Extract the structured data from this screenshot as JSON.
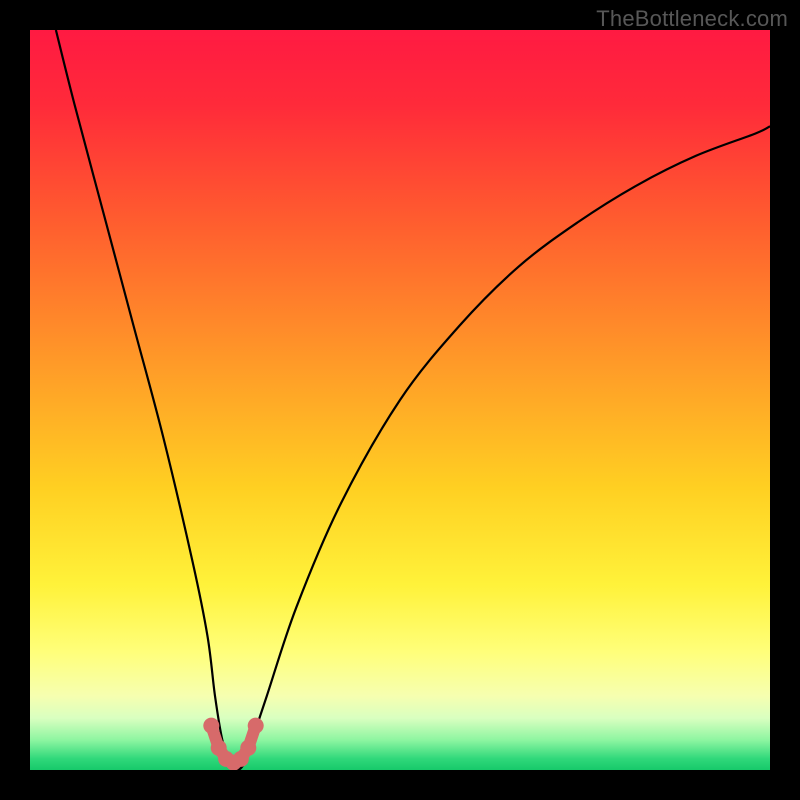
{
  "watermark": "TheBottleneck.com",
  "chart_data": {
    "type": "line",
    "title": "",
    "xlabel": "",
    "ylabel": "",
    "xlim": [
      0,
      100
    ],
    "ylim": [
      0,
      100
    ],
    "series": [
      {
        "name": "bottleneck-curve",
        "x": [
          3.5,
          6,
          10,
          14,
          18,
          22,
          24,
          25,
          26,
          27,
          28,
          29,
          30,
          32,
          36,
          42,
          50,
          58,
          66,
          74,
          82,
          90,
          98,
          100
        ],
        "y": [
          100,
          90,
          75,
          60,
          45,
          28,
          18,
          10,
          4,
          1,
          0,
          1,
          4,
          10,
          22,
          36,
          50,
          60,
          68,
          74,
          79,
          83,
          86,
          87
        ]
      }
    ],
    "markers": {
      "name": "valley-markers",
      "color": "#d76a6a",
      "x": [
        24.5,
        25.5,
        26.5,
        27.5,
        28.5,
        29.5,
        30.5
      ],
      "y": [
        6,
        3,
        1.5,
        1,
        1.5,
        3,
        6
      ]
    },
    "background_gradient_stops": [
      {
        "offset": 0.0,
        "color": "#ff1a42"
      },
      {
        "offset": 0.1,
        "color": "#ff2a3a"
      },
      {
        "offset": 0.25,
        "color": "#ff5a2f"
      },
      {
        "offset": 0.45,
        "color": "#ff9a28"
      },
      {
        "offset": 0.62,
        "color": "#ffd022"
      },
      {
        "offset": 0.75,
        "color": "#fff23a"
      },
      {
        "offset": 0.84,
        "color": "#ffff7a"
      },
      {
        "offset": 0.9,
        "color": "#f6ffb0"
      },
      {
        "offset": 0.93,
        "color": "#d9ffc0"
      },
      {
        "offset": 0.96,
        "color": "#8cf5a0"
      },
      {
        "offset": 0.985,
        "color": "#2fd87a"
      },
      {
        "offset": 1.0,
        "color": "#17c96a"
      }
    ]
  }
}
